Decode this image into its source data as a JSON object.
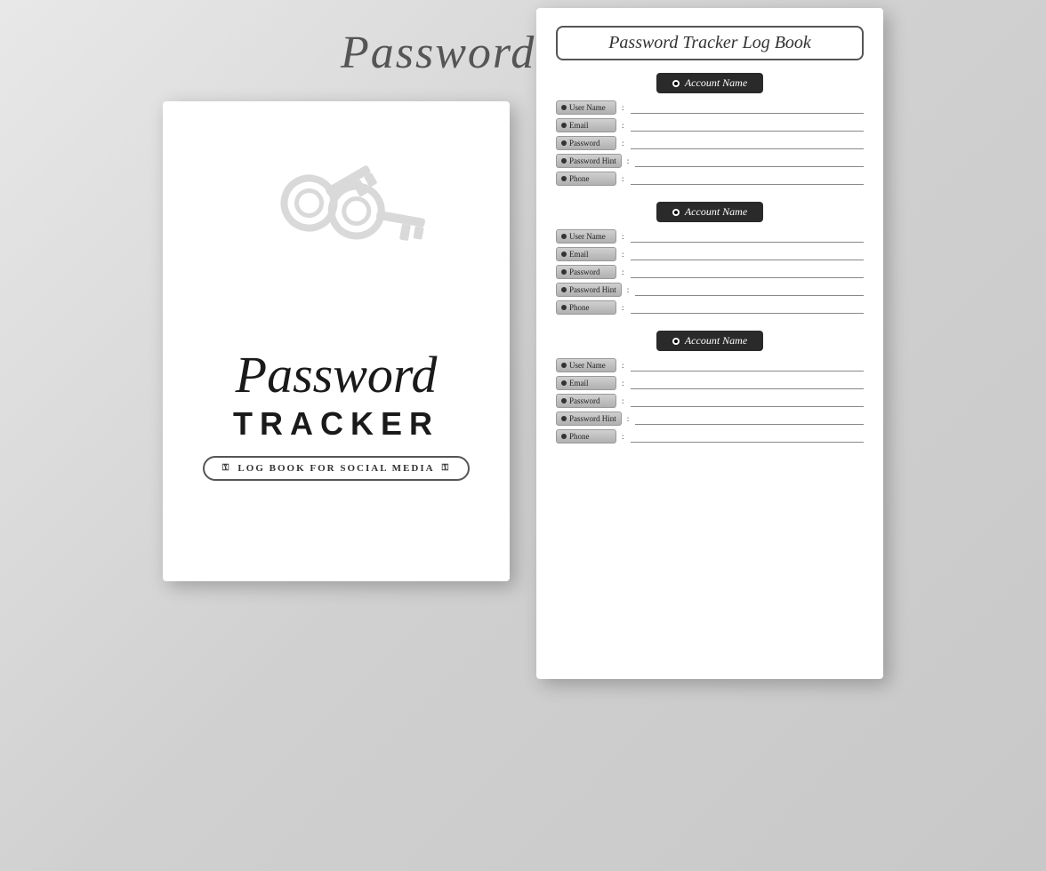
{
  "header": {
    "title": "Password Tracker"
  },
  "left_card": {
    "cover_password": "Password",
    "cover_tracker": "TRACKER",
    "logbook_label": "LOG BOOK FOR SOCIAL MEDIA"
  },
  "right_card": {
    "title": "Password Tracker Log Book",
    "sections": [
      {
        "account_name": "Account Name",
        "fields": [
          {
            "label": "User Name",
            "colon": ":"
          },
          {
            "label": "Email",
            "colon": ":"
          },
          {
            "label": "Password",
            "colon": ":"
          },
          {
            "label": "Password Hint",
            "colon": ":"
          },
          {
            "label": "Phone",
            "colon": ":"
          }
        ]
      },
      {
        "account_name": "Account Name",
        "fields": [
          {
            "label": "User Name",
            "colon": ":"
          },
          {
            "label": "Email",
            "colon": ":"
          },
          {
            "label": "Password",
            "colon": ":"
          },
          {
            "label": "Password Hint",
            "colon": ":"
          },
          {
            "label": "Phone",
            "colon": ":"
          }
        ]
      },
      {
        "account_name": "Account Name",
        "fields": [
          {
            "label": "User Name",
            "colon": ":"
          },
          {
            "label": "Email",
            "colon": ":"
          },
          {
            "label": "Password",
            "colon": ":"
          },
          {
            "label": "Password Hint",
            "colon": ":"
          },
          {
            "label": "Phone",
            "colon": ":"
          }
        ]
      }
    ]
  }
}
